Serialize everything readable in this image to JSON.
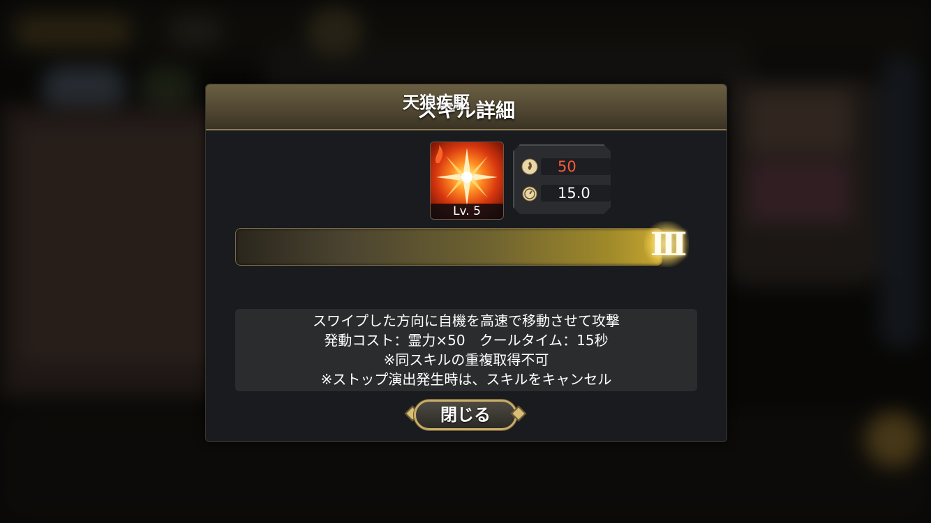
{
  "dialog": {
    "title": "スキル詳細",
    "skill": {
      "icon": "fire-starburst-icon",
      "level_label": "Lv. 5",
      "name": "天狼疾駆",
      "rank": "III"
    },
    "stats": {
      "cost_icon": "spirit-flame-icon",
      "cost_value": "50",
      "cooldown_icon": "stopwatch-icon",
      "cooldown_value": "15.0"
    },
    "description": [
      "スワイプした方向に自機を高速で移動させて攻撃",
      "発動コスト：霊力×50　クールタイム：15秒",
      "※同スキルの重複取得不可",
      "※ストップ演出発生時は、スキルをキャンセル"
    ],
    "close_label": "閉じる"
  },
  "colors": {
    "accent_gold": "#c9ae6a",
    "cost_red": "#ff5a3a",
    "panel_bg": "#1a1b1e"
  }
}
